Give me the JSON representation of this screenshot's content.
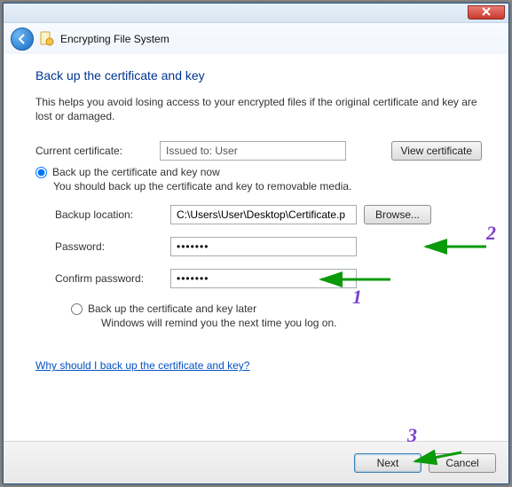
{
  "window": {
    "title": "Encrypting File System"
  },
  "page": {
    "heading": "Back up the certificate and key",
    "help": "This helps you avoid losing access to your encrypted files if the original certificate and key are lost or damaged.",
    "currentCertLabel": "Current certificate:",
    "currentCertValue": "Issued to: User",
    "viewCertBtn": "View certificate",
    "radioNow": "Back up the certificate and key now",
    "radioNowSub": "You should back up the certificate and key to removable media.",
    "backupLocLabel": "Backup location:",
    "backupLocValue": "C:\\Users\\User\\Desktop\\Certificate.p",
    "browseBtn": "Browse...",
    "passwordLabel": "Password:",
    "passwordValue": "•••••••",
    "confirmLabel": "Confirm password:",
    "confirmValue": "•••••••",
    "radioLater": "Back up the certificate and key later",
    "radioLaterSub": "Windows will remind you the next time you log on.",
    "whyLink": "Why should I back up the certificate and key?",
    "next": "Next",
    "cancel": "Cancel"
  },
  "anno": {
    "n1": "1",
    "n2": "2",
    "n3": "3"
  }
}
